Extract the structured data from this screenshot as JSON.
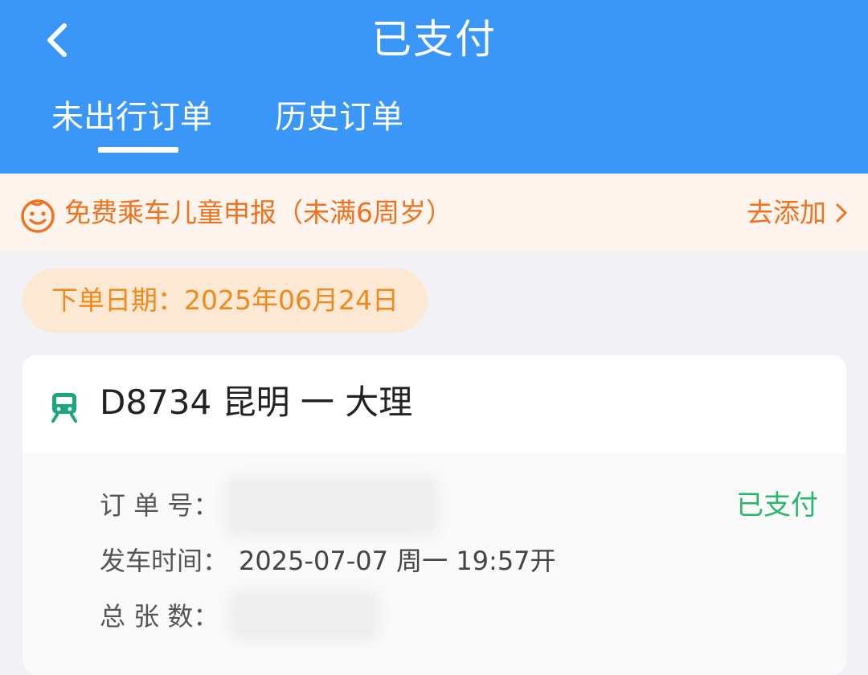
{
  "header": {
    "title": "已支付",
    "tabs": [
      {
        "label": "未出行订单",
        "active": true
      },
      {
        "label": "历史订单",
        "active": false
      }
    ]
  },
  "notice": {
    "text": "免费乘车儿童申报（未满6周岁）",
    "action": "去添加"
  },
  "order_date": "下单日期：2025年06月24日",
  "order": {
    "train_line": "D8734  昆明 一 大理",
    "order_no_label": "订 单 号：",
    "depart_label": "发车时间：",
    "depart_value": "2025-07-07  周一  19:57开",
    "tickets_label": "总 张 数：",
    "status": "已支付"
  },
  "colors": {
    "header_bg": "#3b97f7",
    "notice_accent": "#f0721f",
    "date_accent": "#f08a1c",
    "status_green": "#27b86b",
    "train_icon": "#1aa77d"
  }
}
